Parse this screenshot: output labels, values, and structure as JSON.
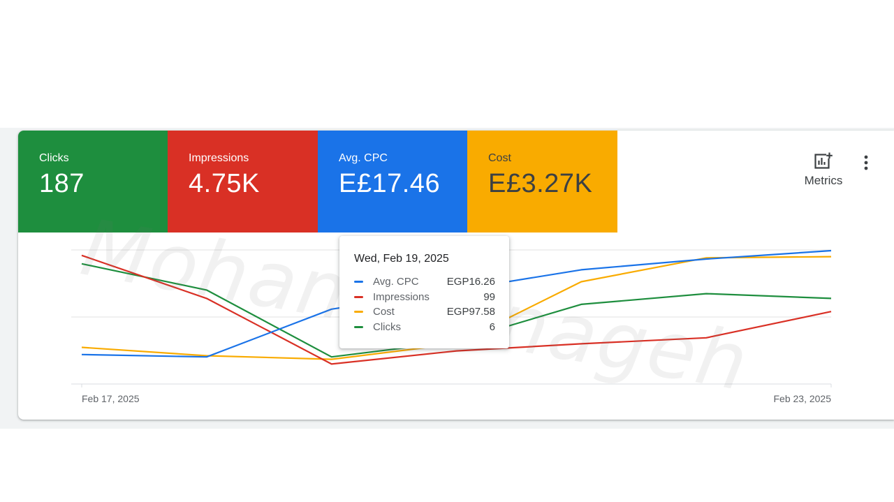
{
  "tiles": [
    {
      "label": "Clicks",
      "value": "187",
      "bg": "#1e8e3e",
      "fg": "#ffffff"
    },
    {
      "label": "Impressions",
      "value": "4.75K",
      "bg": "#d93025",
      "fg": "#ffffff"
    },
    {
      "label": "Avg. CPC",
      "value": "E£17.46",
      "bg": "#1a73e8",
      "fg": "#ffffff"
    },
    {
      "label": "Cost",
      "value": "E£3.27K",
      "bg": "#f9ab00",
      "fg": "#3c4043"
    }
  ],
  "toolbar": {
    "metrics_label": "Metrics",
    "metrics_icon": "add-chart-icon",
    "more_icon": "more-vert-icon"
  },
  "watermark": "Mohamed nageh",
  "tooltip": {
    "date": "Wed, Feb 19, 2025",
    "rows": [
      {
        "name": "Avg. CPC",
        "value": "EGP16.26",
        "color": "#1a73e8"
      },
      {
        "name": "Impressions",
        "value": "99",
        "color": "#d93025"
      },
      {
        "name": "Cost",
        "value": "EGP97.58",
        "color": "#f9ab00"
      },
      {
        "name": "Clicks",
        "value": "6",
        "color": "#1e8e3e"
      }
    ]
  },
  "chart_data": {
    "type": "line",
    "x": [
      "Feb 17, 2025",
      "Feb 18, 2025",
      "Feb 19, 2025",
      "Feb 20, 2025",
      "Feb 21, 2025",
      "Feb 22, 2025",
      "Feb 23, 2025"
    ],
    "x_tick_labels": [
      "Feb 17, 2025",
      "Feb 23, 2025"
    ],
    "normalized_per_series": true,
    "ylim": [
      0,
      1
    ],
    "grid": true,
    "series": [
      {
        "name": "Avg. CPC",
        "color": "#1a73e8",
        "values": [
          0.13,
          0.11,
          0.51,
          0.67,
          0.84,
          0.93,
          1.0
        ]
      },
      {
        "name": "Impressions",
        "color": "#d93025",
        "values": [
          0.96,
          0.6,
          0.05,
          0.16,
          0.22,
          0.27,
          0.49
        ]
      },
      {
        "name": "Cost",
        "color": "#f9ab00",
        "values": [
          0.19,
          0.12,
          0.09,
          0.22,
          0.74,
          0.94,
          0.95
        ]
      },
      {
        "name": "Clicks",
        "color": "#1e8e3e",
        "values": [
          0.89,
          0.67,
          0.11,
          0.24,
          0.55,
          0.64,
          0.6
        ]
      }
    ]
  }
}
